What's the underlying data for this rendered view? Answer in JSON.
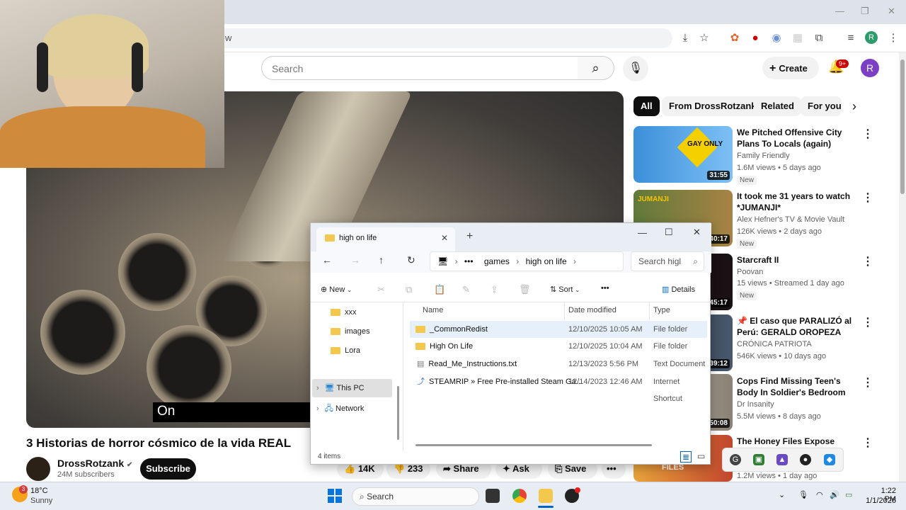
{
  "browser": {
    "address_fragment": "w",
    "window_controls": {
      "minimize": "—",
      "maximize": "❐",
      "close": "✕"
    }
  },
  "youtube": {
    "search_placeholder": "Search",
    "create_label": "Create",
    "notif_count": "9+",
    "avatar_letter": "R",
    "chips": [
      "All",
      "From DrossRotzank",
      "Related",
      "For you"
    ],
    "video": {
      "caption": "On",
      "title": "3 Historias de horror cósmico de la vida REAL",
      "channel": "DrossRotzank",
      "verified": "✔",
      "subscribers": "24M subscribers",
      "subscribe_label": "Subscribe",
      "likes": "14K",
      "dislikes": "233",
      "share_label": "Share",
      "ask_label": "Ask",
      "save_label": "Save",
      "more_label": "•••"
    },
    "related": [
      {
        "title": "We Pitched Offensive City Plans To Locals (again)",
        "channel": "Family Friendly",
        "meta": "1.6M views • 5 days ago",
        "badge": "New",
        "duration": "31:55",
        "thumb_text": "GAY ONLY"
      },
      {
        "title": "It took me 31 years to watch *JUMANJI*",
        "channel": "Alex Hefner's TV & Movie Vault",
        "meta": "126K views • 2 days ago",
        "badge": "New",
        "duration": "40:17",
        "thumb_text": "JUMANJI"
      },
      {
        "title": "Starcraft II",
        "channel": "Poovan",
        "meta": "15 views • Streamed 1 day ago",
        "badge": "New",
        "duration": "45:17"
      },
      {
        "title": "📌 El caso que PARALIZÓ al Perú: GERALD OROPEZA",
        "channel": "CRÓNICA PATRIOTA",
        "meta": "546K views • 10 days ago",
        "badge": "",
        "duration": "39:12"
      },
      {
        "title": "Cops Find Missing Teen's Body In Soldier's Bedroom",
        "channel": "Dr Insanity",
        "meta": "5.5M views • 8 days ago",
        "badge": "",
        "duration": "50:08"
      },
      {
        "title": "The Honey Files Expose Major",
        "channel": "",
        "meta": "1.2M views • 1 day ago",
        "badge": "",
        "duration": "",
        "thumb_text": "FILES"
      }
    ]
  },
  "explorer": {
    "tab_title": "high on life",
    "new_tab": "+",
    "breadcrumb": [
      "•••",
      "games",
      "high on life"
    ],
    "search_placeholder": "Search higl",
    "new_label": "New",
    "sort_label": "Sort",
    "more_label": "•••",
    "details_label": "Details",
    "nav_items": [
      "xxx",
      "images",
      "Lora",
      "This PC",
      "Network"
    ],
    "columns": {
      "name": "Name",
      "date": "Date modified",
      "type": "Type"
    },
    "files": [
      {
        "name": "_CommonRedist",
        "date": "12/10/2025 10:05 AM",
        "type": "File folder",
        "kind": "folder"
      },
      {
        "name": "High On Life",
        "date": "12/10/2025 10:04 AM",
        "type": "File folder",
        "kind": "folder"
      },
      {
        "name": "Read_Me_Instructions.txt",
        "date": "12/13/2023 5:56 PM",
        "type": "Text Document",
        "kind": "txt"
      },
      {
        "name": "STEAMRIP  » Free Pre-installed Steam Ga...",
        "date": "12/14/2023 12:46 AM",
        "type": "Internet Shortcut",
        "kind": "link"
      }
    ],
    "status": "4 items"
  },
  "taskbar": {
    "weather_temp": "18°C",
    "weather_desc": "Sunny",
    "weather_badge": "3",
    "search_label": "Search",
    "time": "1:22 PM",
    "date": "1/1/2026"
  },
  "colors": {
    "yt_red": "#cc0000",
    "folder": "#f4c74f",
    "accent": "#0067c0"
  }
}
